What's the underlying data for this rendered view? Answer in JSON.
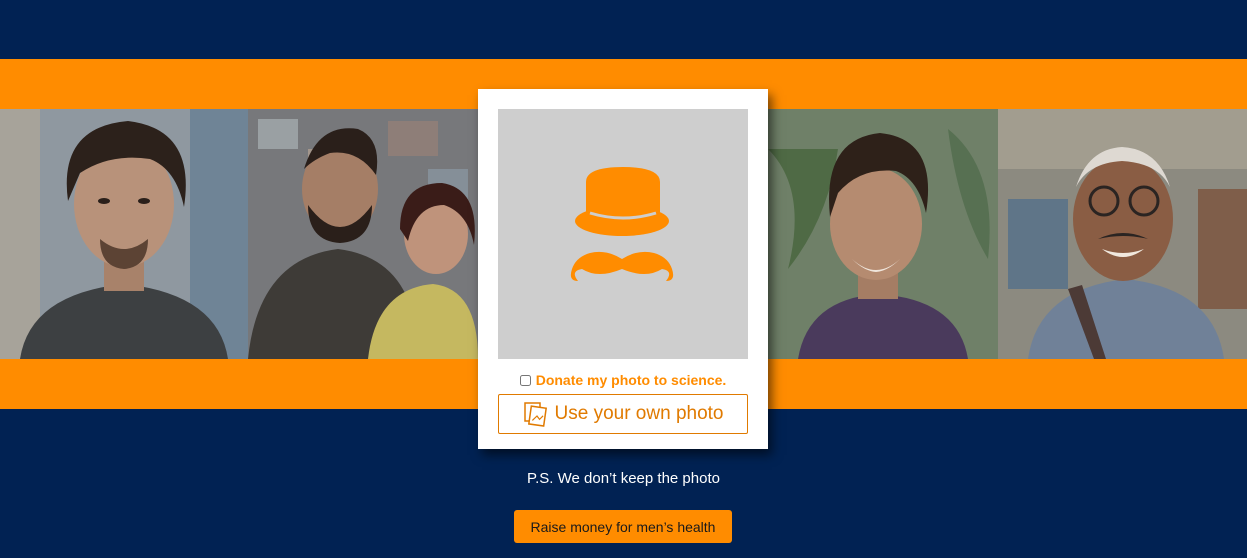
{
  "card": {
    "donate_label": "Donate my photo to science.",
    "use_photo_label": "Use your own photo"
  },
  "footer": {
    "privacy_note": "P.S. We don’t keep the photo",
    "raise_button_label": "Raise money for men’s health"
  },
  "colors": {
    "background": "#012253",
    "accent": "#ff8c00",
    "preview_bg": "#cecece"
  },
  "icons": {
    "avatar_placeholder": "hat-and-mustache-icon",
    "upload": "photos-icon"
  }
}
